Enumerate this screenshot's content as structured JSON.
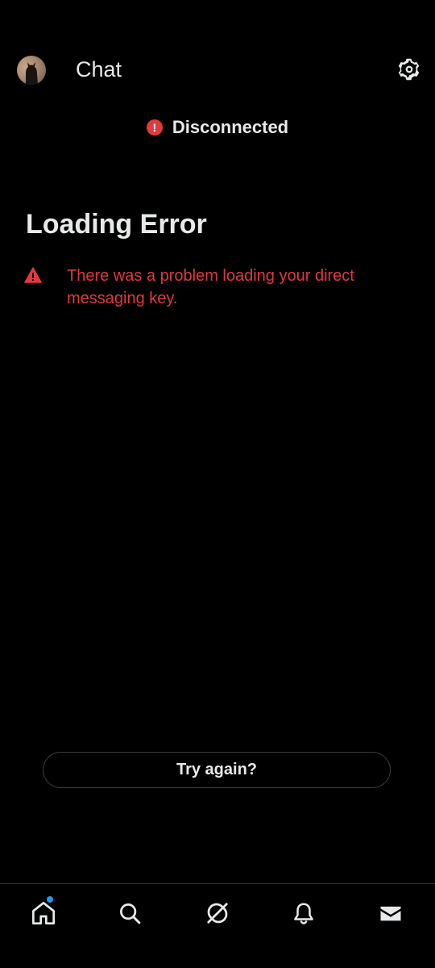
{
  "header": {
    "title": "Chat",
    "avatar_icon": "user-avatar",
    "settings_icon": "gear-icon"
  },
  "status": {
    "icon": "error-circle-icon",
    "icon_glyph": "!",
    "text": "Disconnected",
    "color": "#e0393e"
  },
  "error": {
    "title": "Loading Error",
    "icon": "warning-triangle-icon",
    "message": "There was a problem loading your direct messaging key.",
    "color": "#e0393e"
  },
  "retry_button": {
    "label": "Try again?"
  },
  "navbar": {
    "items": [
      {
        "name": "home",
        "icon": "home-icon",
        "has_notification": true
      },
      {
        "name": "search",
        "icon": "search-icon",
        "has_notification": false
      },
      {
        "name": "grok",
        "icon": "grok-icon",
        "has_notification": false
      },
      {
        "name": "notifications",
        "icon": "bell-icon",
        "has_notification": false
      },
      {
        "name": "messages",
        "icon": "envelope-icon",
        "has_notification": false
      }
    ],
    "notification_color": "#1d9bf0"
  }
}
